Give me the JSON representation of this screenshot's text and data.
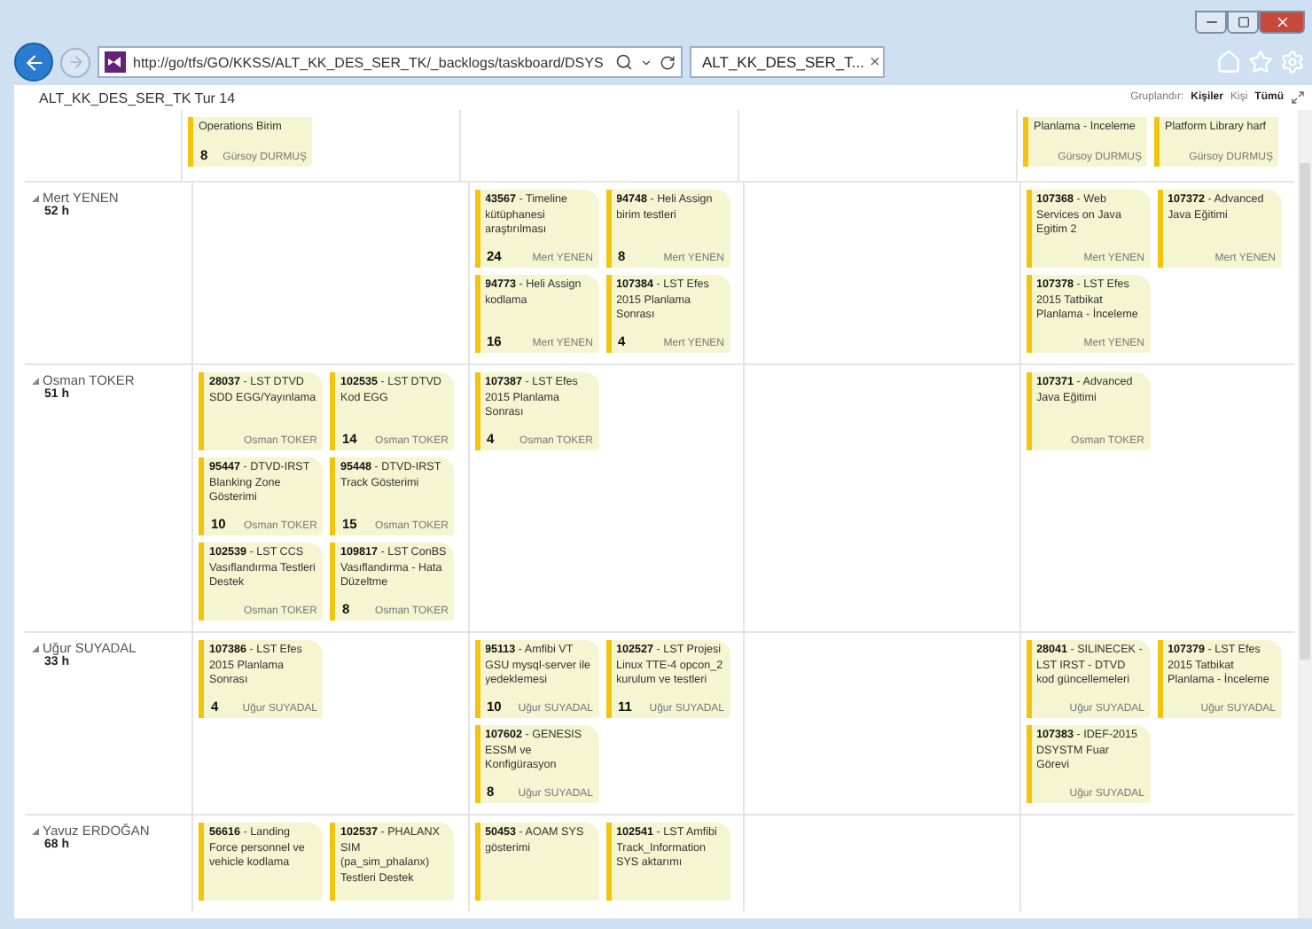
{
  "browser": {
    "address": "http://go/tfs/GO/KKSS/ALT_KK_DES_SER_TK/_backlogs/taskboard/DSYS",
    "tab_title": "ALT_KK_DES_SER_T...",
    "tab_close": "×"
  },
  "page": {
    "title": "ALT_KK_DES_SER_TK Tur 14",
    "group_label": "Gruplandır:",
    "group_value": "Kişiler",
    "person_label": "Kişi",
    "person_value": "Tümü"
  },
  "lanes": [
    {
      "columns": [
        [
          {
            "title": "Operations Birim",
            "hours": "8",
            "person": "Gürsoy DURMUŞ"
          }
        ],
        [],
        [],
        [
          {
            "title": "Planlama - İnceleme",
            "person": "Gürsoy DURMUŞ"
          },
          {
            "title": "Platform Library harf",
            "person": "Gürsoy DURMUŞ"
          }
        ]
      ]
    },
    {
      "name": "Mert YENEN",
      "hours": "52 h",
      "columns": [
        [],
        [
          {
            "title": "**43567** - Timeline kütüphanesi araştırılması",
            "hours": "24",
            "person": "Mert YENEN"
          },
          {
            "title": "**94748** - Heli Assign birim testleri",
            "hours": "8",
            "person": "Mert YENEN"
          },
          {
            "title": "**94773** - Heli Assign kodlama",
            "hours": "16",
            "person": "Mert YENEN"
          },
          {
            "title": "**107384** - LST Efes 2015 Planlama Sonrası",
            "hours": "4",
            "person": "Mert YENEN"
          }
        ],
        [],
        [
          {
            "title": "**107368** - Web Services on Java Egitim 2",
            "person": "Mert YENEN"
          },
          {
            "title": "**107372** - Advanced Java Eğitimi",
            "person": "Mert YENEN"
          },
          {
            "title": "**107378** - LST Efes 2015 Tatbikat Planlama - İnceleme",
            "person": "Mert YENEN"
          }
        ]
      ]
    },
    {
      "name": "Osman TOKER",
      "hours": "51 h",
      "columns": [
        [
          {
            "title": "**28037** - LST DTVD SDD EGG/Yayınlama",
            "person": "Osman TOKER"
          },
          {
            "title": "**102535** - LST DTVD Kod EGG",
            "hours": "14",
            "person": "Osman TOKER"
          },
          {
            "title": "**95447** - DTVD-IRST Blanking Zone Gösterimi",
            "hours": "10",
            "person": "Osman TOKER"
          },
          {
            "title": "**95448** - DTVD-IRST Track Gösterimi",
            "hours": "15",
            "person": "Osman TOKER"
          },
          {
            "title": "**102539** - LST CCS Vasıflandırma Testleri Destek",
            "person": "Osman TOKER"
          },
          {
            "title": "**109817** - LST ConBS Vasıflandırma - Hata Düzeltme",
            "hours": "8",
            "person": "Osman TOKER"
          }
        ],
        [
          {
            "title": "**107387** - LST Efes 2015 Planlama Sonrası",
            "hours": "4",
            "person": "Osman TOKER"
          }
        ],
        [],
        [
          {
            "title": "**107371** - Advanced Java Eğitimi",
            "person": "Osman TOKER"
          }
        ]
      ]
    },
    {
      "name": "Uğur SUYADAL",
      "hours": "33 h",
      "columns": [
        [
          {
            "title": "**107386** - LST Efes 2015 Planlama Sonrası",
            "hours": "4",
            "person": "Uğur SUYADAL"
          }
        ],
        [
          {
            "title": "**95113** - Amfibi VT GSU mysql-server ile yedeklemesi",
            "hours": "10",
            "person": "Uğur SUYADAL"
          },
          {
            "title": "**102527** - LST Projesi Linux TTE-4 opcon_2 kurulum ve testleri",
            "hours": "11",
            "person": "Uğur SUYADAL"
          },
          {
            "title": "**107602** - GENESIS ESSM ve Konfigürasyon",
            "hours": "8",
            "person": "Uğur SUYADAL"
          }
        ],
        [],
        [
          {
            "title": "**28041** - SİLİNECEK - LST IRST - DTVD kod güncellemeleri",
            "person": "Uğur SUYADAL"
          },
          {
            "title": "**107379** - LST Efes 2015 Tatbikat Planlama - İnceleme",
            "person": "Uğur SUYADAL"
          },
          {
            "title": "**107383** - IDEF-2015 DSYSTM Fuar Görevi",
            "person": "Uğur SUYADAL"
          }
        ]
      ]
    },
    {
      "name": "Yavuz ERDOĞAN",
      "hours": "68 h",
      "columns": [
        [
          {
            "title": "**56616** - Landing Force personnel ve vehicle kodlama"
          },
          {
            "title": "**102537** - PHALANX SIM (pa_sim_phalanx) Testleri Destek"
          }
        ],
        [
          {
            "title": "**50453** - AOAM SYS gösterimi"
          },
          {
            "title": "**102541** - LST Amfibi Track_Information SYS aktarımı"
          }
        ],
        [],
        []
      ]
    }
  ]
}
